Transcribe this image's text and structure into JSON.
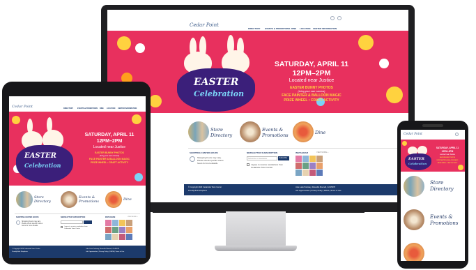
{
  "site": {
    "logo": "Cedar Point",
    "nav": [
      "DIRECTORY",
      "EVENTS & PROMOTIONS",
      "DINE",
      "LOCATION",
      "CENTER INFORMATION"
    ]
  },
  "promo": {
    "date": "SATURDAY, APRIL 11",
    "time": "12PM–2PM",
    "location": "Located near Justice",
    "line1": "EASTER BUNNY PHOTOS",
    "line1_sub": "(bring your own camera)",
    "line2": "FACE PAINTER & BALLOON MAGIC",
    "line3": "PRIZE WHEEL • CRAFT ACTIVITY",
    "easter_word": "EASTER",
    "celebration_word": "Celebration"
  },
  "categories": {
    "store": "Store Directory",
    "store_l1": "Store",
    "store_l2": "Directory",
    "events": "Events & Promotions",
    "events_l1": "Events &",
    "events_l2": "Promotions",
    "dine": "Dine"
  },
  "info": {
    "hours_title": "SHOPPING CENTER HOURS",
    "hours_text": "Shopping hours may vary.",
    "hours_text2": "Please check specific stores",
    "hours_text3": "hours for more details.",
    "newsletter_title": "NEWSLETTER SUBSCRIPTION",
    "newsletter_placeholder": "Subscribe to Newsletter",
    "subscribe_label": "Subscribe",
    "agree_text": "I agree to receive newsletters from",
    "agree_text2": "Cedarside Town Center",
    "instagram_title": "INSTAGRAM",
    "view_more": "VIEW MORE »"
  },
  "footer": {
    "copyright": "© Copyright 2020 Cedarside Town Center",
    "designed": "Proudly Built Shopforce",
    "address": "Juke Lake Parkway, Roseville Moonoll, CA 95678",
    "links": "Job Opportunities | Privacy Policy | DMCA | Terms of Use"
  },
  "colors": {
    "pink": "#e8305e",
    "navy": "#1c3a6b",
    "purple": "#3b1f7a",
    "yellow": "#ffd23f"
  }
}
